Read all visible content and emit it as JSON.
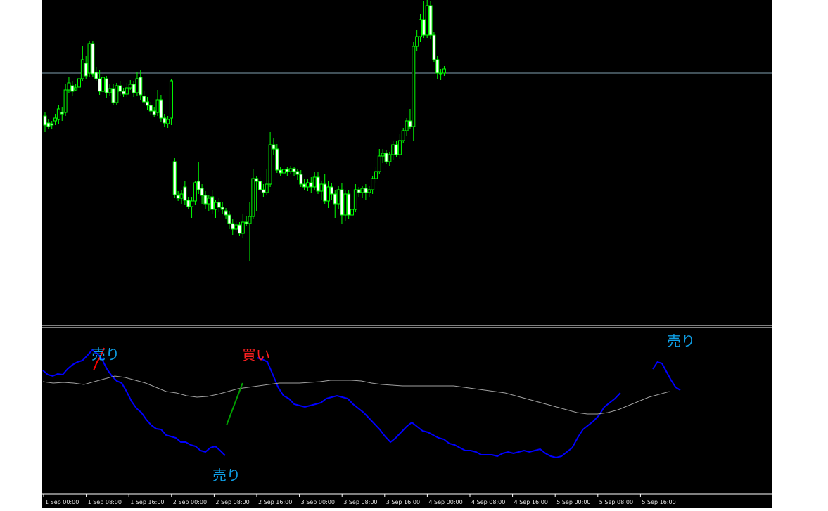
{
  "chart_data": [
    {
      "type": "candlestick",
      "x_labels": [
        "1 Sep 00:00",
        "1 Sep 08:00",
        "1 Sep 16:00",
        "2 Sep 00:00",
        "2 Sep 08:00",
        "2 Sep 16:00",
        "3 Sep 00:00",
        "3 Sep 08:00",
        "3 Sep 16:00",
        "4 Sep 00:00",
        "4 Sep 08:00",
        "4 Sep 16:00",
        "5 Sep 00:00",
        "5 Sep 08:00",
        "5 Sep 16:00"
      ],
      "candles": [
        {
          "o": 165,
          "c": 178,
          "h": 160,
          "l": 188
        },
        {
          "o": 175,
          "c": 180,
          "h": 170,
          "l": 184
        },
        {
          "o": 176,
          "c": 178,
          "h": 172,
          "l": 184
        },
        {
          "o": 172,
          "c": 168,
          "h": 162,
          "l": 178
        },
        {
          "o": 170,
          "c": 155,
          "h": 150,
          "l": 176
        },
        {
          "o": 160,
          "c": 162,
          "h": 152,
          "l": 172
        },
        {
          "o": 160,
          "c": 128,
          "h": 120,
          "l": 165
        },
        {
          "o": 128,
          "c": 118,
          "h": 110,
          "l": 132
        },
        {
          "o": 122,
          "c": 130,
          "h": 115,
          "l": 136
        },
        {
          "o": 128,
          "c": 125,
          "h": 120,
          "l": 130
        },
        {
          "o": 124,
          "c": 112,
          "h": 105,
          "l": 128
        },
        {
          "o": 112,
          "c": 85,
          "h": 65,
          "l": 115
        },
        {
          "o": 90,
          "c": 108,
          "h": 80,
          "l": 112
        },
        {
          "o": 104,
          "c": 62,
          "h": 58,
          "l": 110
        },
        {
          "o": 62,
          "c": 105,
          "h": 58,
          "l": 110
        },
        {
          "o": 103,
          "c": 112,
          "h": 95,
          "l": 115
        },
        {
          "o": 112,
          "c": 130,
          "h": 100,
          "l": 135
        },
        {
          "o": 130,
          "c": 110,
          "h": 105,
          "l": 133
        },
        {
          "o": 112,
          "c": 132,
          "h": 108,
          "l": 140
        },
        {
          "o": 132,
          "c": 126,
          "h": 120,
          "l": 137
        },
        {
          "o": 126,
          "c": 146,
          "h": 120,
          "l": 150
        },
        {
          "o": 146,
          "c": 122,
          "h": 118,
          "l": 150
        },
        {
          "o": 122,
          "c": 130,
          "h": 115,
          "l": 136
        },
        {
          "o": 130,
          "c": 134,
          "h": 125,
          "l": 138
        },
        {
          "o": 134,
          "c": 125,
          "h": 118,
          "l": 138
        },
        {
          "o": 125,
          "c": 120,
          "h": 114,
          "l": 128
        },
        {
          "o": 120,
          "c": 132,
          "h": 115,
          "l": 138
        },
        {
          "o": 132,
          "c": 112,
          "h": 103,
          "l": 136
        },
        {
          "o": 110,
          "c": 135,
          "h": 100,
          "l": 142
        },
        {
          "o": 137,
          "c": 145,
          "h": 130,
          "l": 150
        },
        {
          "o": 145,
          "c": 150,
          "h": 138,
          "l": 157
        },
        {
          "o": 150,
          "c": 158,
          "h": 145,
          "l": 163
        },
        {
          "o": 158,
          "c": 163,
          "h": 152,
          "l": 167
        },
        {
          "o": 160,
          "c": 142,
          "h": 128,
          "l": 165
        },
        {
          "o": 142,
          "c": 168,
          "h": 135,
          "l": 174
        },
        {
          "o": 168,
          "c": 175,
          "h": 162,
          "l": 180
        },
        {
          "o": 176,
          "c": 170,
          "h": 165,
          "l": 182
        },
        {
          "o": 168,
          "c": 115,
          "h": 112,
          "l": 178
        },
        {
          "o": 230,
          "c": 277,
          "h": 225,
          "l": 282
        },
        {
          "o": 278,
          "c": 282,
          "h": 272,
          "l": 286
        },
        {
          "o": 282,
          "c": 276,
          "h": 270,
          "l": 290
        },
        {
          "o": 266,
          "c": 285,
          "h": 258,
          "l": 292
        },
        {
          "o": 285,
          "c": 294,
          "h": 280,
          "l": 297
        },
        {
          "o": 294,
          "c": 286,
          "h": 280,
          "l": 310
        },
        {
          "o": 286,
          "c": 260,
          "h": 258,
          "l": 292
        },
        {
          "o": 258,
          "c": 270,
          "h": 230,
          "l": 276
        },
        {
          "o": 268,
          "c": 278,
          "h": 262,
          "l": 290
        },
        {
          "o": 278,
          "c": 290,
          "h": 272,
          "l": 297
        },
        {
          "o": 290,
          "c": 282,
          "h": 278,
          "l": 300
        },
        {
          "o": 280,
          "c": 298,
          "h": 270,
          "l": 304
        },
        {
          "o": 298,
          "c": 288,
          "h": 284,
          "l": 310
        },
        {
          "o": 288,
          "c": 295,
          "h": 282,
          "l": 302
        },
        {
          "o": 295,
          "c": 298,
          "h": 288,
          "l": 305
        },
        {
          "o": 300,
          "c": 306,
          "h": 296,
          "l": 312
        },
        {
          "o": 306,
          "c": 318,
          "h": 300,
          "l": 326
        },
        {
          "o": 318,
          "c": 326,
          "h": 312,
          "l": 334
        },
        {
          "o": 326,
          "c": 320,
          "h": 315,
          "l": 330
        },
        {
          "o": 320,
          "c": 332,
          "h": 316,
          "l": 336
        },
        {
          "o": 332,
          "c": 316,
          "h": 305,
          "l": 338
        },
        {
          "o": 316,
          "c": 318,
          "h": 308,
          "l": 322
        },
        {
          "o": 318,
          "c": 308,
          "h": 288,
          "l": 372
        },
        {
          "o": 308,
          "c": 254,
          "h": 240,
          "l": 312
        },
        {
          "o": 254,
          "c": 258,
          "h": 250,
          "l": 300
        },
        {
          "o": 258,
          "c": 270,
          "h": 252,
          "l": 275
        },
        {
          "o": 270,
          "c": 274,
          "h": 262,
          "l": 280
        },
        {
          "o": 274,
          "c": 262,
          "h": 240,
          "l": 278
        },
        {
          "o": 262,
          "c": 206,
          "h": 188,
          "l": 266
        },
        {
          "o": 206,
          "c": 212,
          "h": 196,
          "l": 220
        },
        {
          "o": 212,
          "c": 242,
          "h": 205,
          "l": 246
        },
        {
          "o": 242,
          "c": 246,
          "h": 238,
          "l": 250
        },
        {
          "o": 246,
          "c": 241,
          "h": 237,
          "l": 252
        },
        {
          "o": 241,
          "c": 244,
          "h": 238,
          "l": 250
        },
        {
          "o": 244,
          "c": 240,
          "h": 236,
          "l": 248
        },
        {
          "o": 240,
          "c": 244,
          "h": 237,
          "l": 250
        },
        {
          "o": 244,
          "c": 248,
          "h": 240,
          "l": 256
        },
        {
          "o": 248,
          "c": 262,
          "h": 242,
          "l": 266
        },
        {
          "o": 262,
          "c": 266,
          "h": 255,
          "l": 270
        },
        {
          "o": 266,
          "c": 260,
          "h": 255,
          "l": 272
        },
        {
          "o": 260,
          "c": 266,
          "h": 252,
          "l": 274
        },
        {
          "o": 266,
          "c": 252,
          "h": 244,
          "l": 270
        },
        {
          "o": 252,
          "c": 272,
          "h": 245,
          "l": 276
        },
        {
          "o": 272,
          "c": 262,
          "h": 258,
          "l": 284
        },
        {
          "o": 262,
          "c": 286,
          "h": 248,
          "l": 290
        },
        {
          "o": 286,
          "c": 266,
          "h": 258,
          "l": 296
        },
        {
          "o": 266,
          "c": 276,
          "h": 260,
          "l": 285
        },
        {
          "o": 276,
          "c": 290,
          "h": 270,
          "l": 310
        },
        {
          "o": 290,
          "c": 270,
          "h": 265,
          "l": 298
        },
        {
          "o": 270,
          "c": 306,
          "h": 260,
          "l": 318
        },
        {
          "o": 306,
          "c": 276,
          "h": 270,
          "l": 314
        },
        {
          "o": 276,
          "c": 306,
          "h": 270,
          "l": 312
        },
        {
          "o": 306,
          "c": 298,
          "h": 290,
          "l": 310
        },
        {
          "o": 298,
          "c": 270,
          "h": 262,
          "l": 302
        },
        {
          "o": 270,
          "c": 274,
          "h": 266,
          "l": 280
        },
        {
          "o": 274,
          "c": 268,
          "h": 264,
          "l": 282
        },
        {
          "o": 268,
          "c": 274,
          "h": 262,
          "l": 284
        },
        {
          "o": 274,
          "c": 270,
          "h": 264,
          "l": 280
        },
        {
          "o": 270,
          "c": 254,
          "h": 250,
          "l": 276
        },
        {
          "o": 254,
          "c": 244,
          "h": 238,
          "l": 260
        },
        {
          "o": 244,
          "c": 222,
          "h": 212,
          "l": 248
        },
        {
          "o": 222,
          "c": 218,
          "h": 212,
          "l": 232
        },
        {
          "o": 218,
          "c": 230,
          "h": 214,
          "l": 234
        },
        {
          "o": 230,
          "c": 220,
          "h": 216,
          "l": 236
        },
        {
          "o": 220,
          "c": 206,
          "h": 200,
          "l": 228
        },
        {
          "o": 206,
          "c": 220,
          "h": 200,
          "l": 224
        },
        {
          "o": 220,
          "c": 200,
          "h": 190,
          "l": 226
        },
        {
          "o": 200,
          "c": 186,
          "h": 182,
          "l": 204
        },
        {
          "o": 186,
          "c": 172,
          "h": 168,
          "l": 194
        },
        {
          "o": 172,
          "c": 180,
          "h": 155,
          "l": 184
        },
        {
          "o": 180,
          "c": 66,
          "h": 60,
          "l": 200
        },
        {
          "o": 66,
          "c": 52,
          "h": 42,
          "l": 72
        },
        {
          "o": 52,
          "c": 28,
          "h": 20,
          "l": 60
        },
        {
          "o": 28,
          "c": 50,
          "h": 2,
          "l": 54
        },
        {
          "o": 50,
          "c": 8,
          "h": 0,
          "l": 54
        },
        {
          "o": 8,
          "c": 50,
          "h": 2,
          "l": 56
        },
        {
          "o": 50,
          "c": 85,
          "h": 45,
          "l": 88
        },
        {
          "o": 85,
          "c": 104,
          "h": 80,
          "l": 112
        },
        {
          "o": 104,
          "c": 104,
          "h": 98,
          "l": 114
        },
        {
          "o": 104,
          "c": 98,
          "h": 94,
          "l": 108
        }
      ],
      "level_line": 104
    },
    {
      "type": "line",
      "x_labels": [
        "1 Sep 00:00",
        "1 Sep 08:00",
        "1 Sep 16:00",
        "2 Sep 00:00",
        "2 Sep 08:00",
        "2 Sep 16:00",
        "3 Sep 00:00",
        "3 Sep 08:00",
        "3 Sep 16:00",
        "4 Sep 00:00",
        "4 Sep 08:00",
        "4 Sep 16:00",
        "5 Sep 00:00",
        "5 Sep 08:00",
        "5 Sep 16:00"
      ],
      "series": [
        {
          "color": "#0000ff",
          "values": [
            58,
            52,
            50,
            53,
            52,
            60,
            66,
            70,
            72,
            79,
            87,
            82,
            74,
            60,
            50,
            43,
            40,
            28,
            14,
            4,
            -2,
            -12,
            -20,
            -25,
            -26,
            -34,
            -36,
            -38,
            -44,
            -44,
            -48,
            -50,
            -56,
            -58,
            -52,
            -50,
            -56,
            -63
          ]
        },
        {
          "color": "#0000ff",
          "values": [
            76,
            74,
            70,
            52,
            34,
            22,
            18,
            10,
            8,
            6,
            8,
            10,
            12,
            18,
            20,
            22,
            20,
            18,
            10,
            4,
            -2,
            -10,
            -18,
            -26,
            -36,
            -44,
            -38,
            -30,
            -22,
            -16,
            -22,
            -28,
            -30,
            -34,
            -38,
            -40,
            -46,
            -48,
            -52,
            -56,
            -56,
            -58,
            -62,
            -62,
            -62,
            -64,
            -60,
            -58,
            -60,
            -58,
            -56,
            -58,
            -56,
            -54,
            -60,
            -64,
            -66,
            -64,
            -58,
            -52,
            -38,
            -26,
            -20,
            -14,
            -6,
            6,
            12,
            18,
            26
          ]
        },
        {
          "color": "#0000ff",
          "values": [
            60,
            70,
            68,
            56,
            44,
            34,
            30
          ]
        },
        {
          "color": "#a0a0a0",
          "values": [
            42,
            40,
            41,
            40,
            38,
            42,
            46,
            50,
            48,
            44,
            40,
            34,
            28,
            26,
            22,
            20,
            21,
            24,
            28,
            32,
            34,
            36,
            38,
            40,
            40,
            40,
            41,
            42,
            44,
            44,
            44,
            43,
            40,
            38,
            37,
            36,
            36,
            36,
            36,
            36,
            36,
            34,
            32,
            30,
            28,
            26,
            22,
            18,
            14,
            10,
            6,
            2,
            -2,
            -4,
            -4,
            -2,
            2,
            8,
            14,
            20,
            24,
            28
          ]
        },
        {
          "color": "#ff0000",
          "values": [
            58,
            70,
            78,
            90
          ]
        },
        {
          "color": "#00a000",
          "values": [
            -20,
            0,
            20,
            40
          ]
        }
      ],
      "annotations": [
        {
          "text": "売り",
          "color": "#0e9fe6"
        },
        {
          "text": "買い",
          "color": "#ff2020"
        },
        {
          "text": "売り",
          "color": "#0e9fe6"
        },
        {
          "text": "売り",
          "color": "#0e9fe6"
        }
      ]
    }
  ]
}
